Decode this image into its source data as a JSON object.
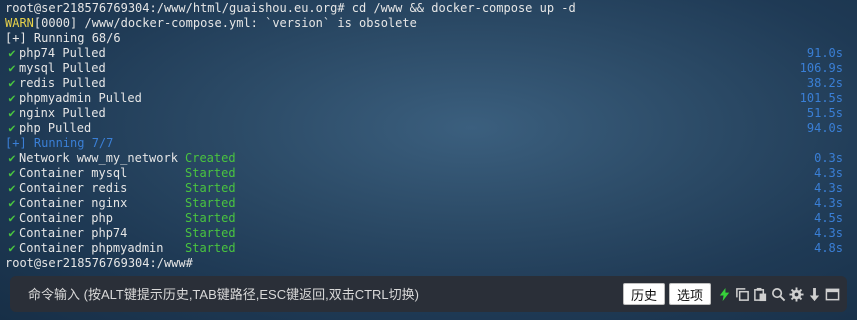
{
  "terminal": {
    "lines": [
      "root@ser218576769304:/www/html/guaishou.eu.org# cd /www && docker-compose up -d",
      "WARN[0000] /www/docker-compose.yml: `version` is obsolete",
      "[+] Running 68/6"
    ],
    "warn_prefix": "WARN",
    "warn_rest": "[0000] /www/docker-compose.yml: `version` is obsolete",
    "check": "✔",
    "pulled": [
      {
        "name": "php74 Pulled",
        "time": "91.0s"
      },
      {
        "name": "mysql Pulled",
        "time": "106.9s"
      },
      {
        "name": "redis Pulled",
        "time": "38.2s"
      },
      {
        "name": "phpmyadmin Pulled",
        "time": "101.5s"
      },
      {
        "name": "nginx Pulled",
        "time": "51.5s"
      },
      {
        "name": "php Pulled",
        "time": "94.0s"
      }
    ],
    "running2": "[+] Running 7/7",
    "containers": [
      {
        "name": "Network www_my_network",
        "status": "Created",
        "time": "0.3s"
      },
      {
        "name": "Container mysql",
        "status": "Started",
        "time": "4.3s"
      },
      {
        "name": "Container redis",
        "status": "Started",
        "time": "4.3s"
      },
      {
        "name": "Container nginx",
        "status": "Started",
        "time": "4.3s"
      },
      {
        "name": "Container php",
        "status": "Started",
        "time": "4.5s"
      },
      {
        "name": "Container php74",
        "status": "Started",
        "time": "4.3s"
      },
      {
        "name": "Container phpmyadmin",
        "status": "Started",
        "time": "4.8s"
      }
    ],
    "prompt": "root@ser218576769304:/www#"
  },
  "commandbar": {
    "placeholder": "命令输入 (按ALT键提示历史,TAB键路径,ESC键返回,双击CTRL切换)",
    "history_label": "历史",
    "options_label": "选项"
  },
  "icons": [
    "lightning-icon",
    "copy-icon",
    "paste-icon",
    "search-icon",
    "gear-icon",
    "arrow-down-icon",
    "maximize-icon"
  ],
  "colors": {
    "warn": "#e8d24a",
    "accent_blue": "#3a7fd6",
    "success_green": "#49c43f"
  }
}
